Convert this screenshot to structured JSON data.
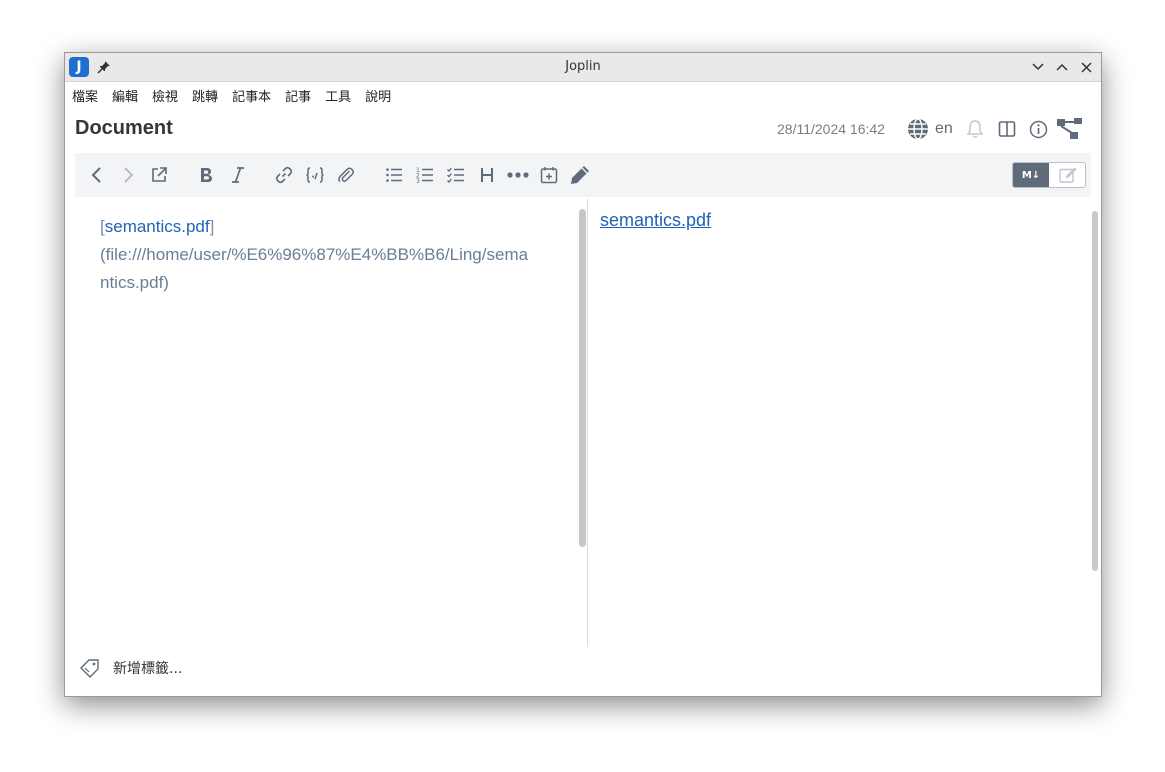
{
  "window": {
    "title": "Joplin",
    "app_icon_letter": "J"
  },
  "menu": [
    "檔案",
    "編輯",
    "檢視",
    "跳轉",
    "記事本",
    "記事",
    "工具",
    "說明"
  ],
  "note": {
    "title": "Document",
    "updated": "28/11/2024 16:42",
    "language": "en"
  },
  "toolbar": {
    "toggle_markdown_label": "M↓",
    "buttons": [
      "back",
      "forward",
      "open-external",
      "bold",
      "italic",
      "link",
      "code",
      "attach",
      "bullet-list",
      "numbered-list",
      "checklist",
      "heading",
      "more",
      "insert-datetime",
      "spellcheck"
    ]
  },
  "editor": {
    "bracket_open": "[",
    "link_text": "semantics.pdf",
    "bracket_close": "]",
    "url_line1": "(file:///home/user/%E6%96%87%E4%BB%B6/Ling/sema",
    "url_line2": "ntics.pdf)"
  },
  "viewer": {
    "link_text": "semantics.pdf"
  },
  "tags": {
    "add_label": "新增標籤..."
  },
  "colors": {
    "accent": "#1f63b5",
    "icon": "#647384",
    "toolbar_bg": "#f3f4f6"
  }
}
